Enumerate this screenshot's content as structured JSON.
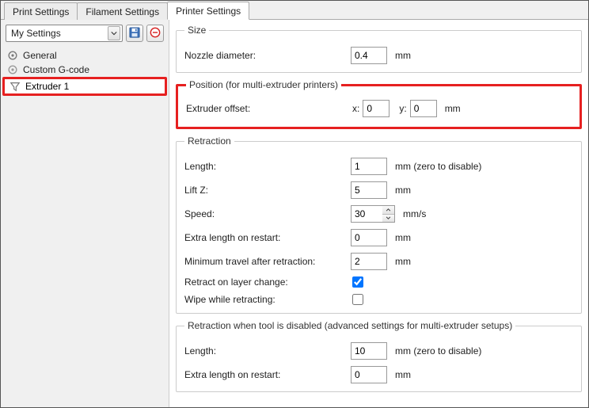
{
  "tabs": {
    "print": "Print Settings",
    "filament": "Filament Settings",
    "printer": "Printer Settings"
  },
  "preset": {
    "selected": "My Settings"
  },
  "sidebar": {
    "general": "General",
    "customgcode": "Custom G-code",
    "extruder1": "Extruder 1"
  },
  "size": {
    "legend": "Size",
    "nozzle_label": "Nozzle diameter:",
    "nozzle_value": "0.4",
    "nozzle_unit": "mm"
  },
  "position": {
    "legend": "Position (for multi-extruder printers)",
    "offset_label": "Extruder offset:",
    "x_label": "x:",
    "x_value": "0",
    "y_label": "y:",
    "y_value": "0",
    "unit": "mm"
  },
  "retraction": {
    "legend": "Retraction",
    "length_label": "Length:",
    "length_value": "1",
    "length_unit": "mm (zero to disable)",
    "liftz_label": "Lift Z:",
    "liftz_value": "5",
    "liftz_unit": "mm",
    "speed_label": "Speed:",
    "speed_value": "30",
    "speed_unit": "mm/s",
    "extra_restart_label": "Extra length on restart:",
    "extra_restart_value": "0",
    "extra_restart_unit": "mm",
    "min_travel_label": "Minimum travel after retraction:",
    "min_travel_value": "2",
    "min_travel_unit": "mm",
    "retract_layerchange_label": "Retract on layer change:",
    "wipe_label": "Wipe while retracting:"
  },
  "retraction_disabled": {
    "legend": "Retraction when tool is disabled (advanced settings for multi-extruder setups)",
    "length_label": "Length:",
    "length_value": "10",
    "length_unit": "mm (zero to disable)",
    "extra_restart_label": "Extra length on restart:",
    "extra_restart_value": "0",
    "extra_restart_unit": "mm"
  }
}
